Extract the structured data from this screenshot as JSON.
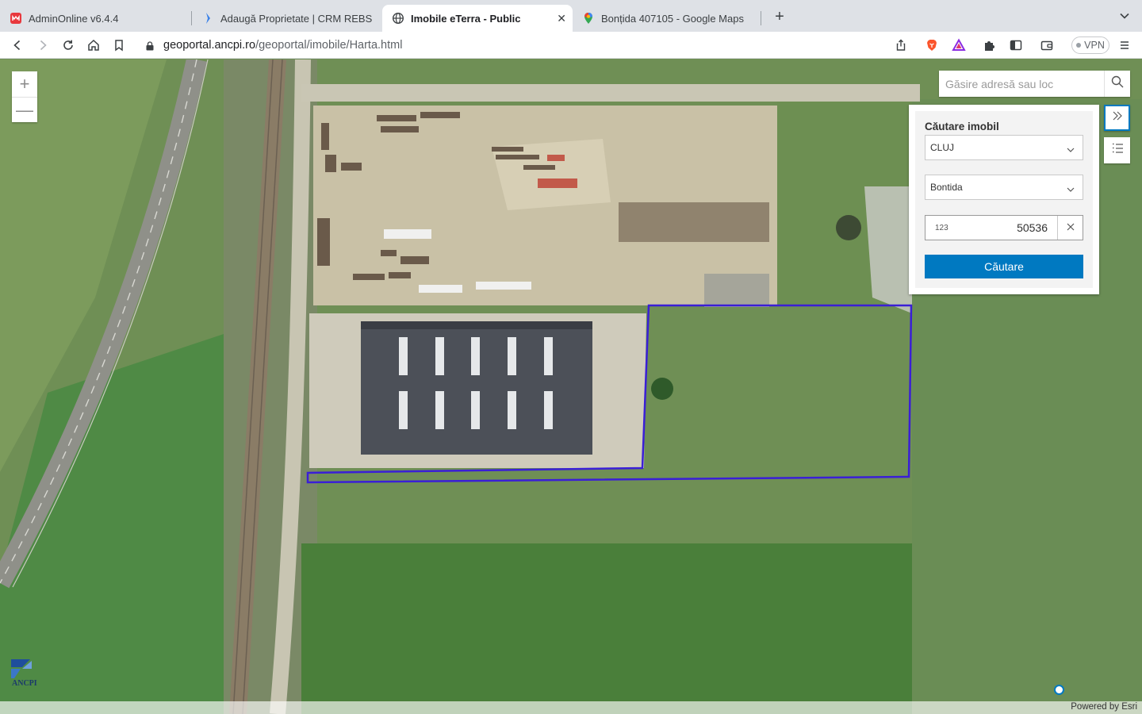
{
  "browser": {
    "tabs": [
      {
        "title": "AdminOnline v6.4.4",
        "icon": "admin-online-icon",
        "active": false
      },
      {
        "title": "Adaugă Proprietate | CRM REBS",
        "icon": "crm-icon",
        "active": false
      },
      {
        "title": "Imobile eTerra - Public",
        "icon": "globe-icon",
        "active": true
      },
      {
        "title": "Bonțida 407105 - Google Maps",
        "icon": "maps-pin-icon",
        "active": false
      }
    ],
    "new_tab_label": "+",
    "url_host": "geoportal.ancpi.ro",
    "url_path": "/geoportal/imobile/Harta.html",
    "vpn_label": "VPN",
    "colors": {
      "tabstrip": "#dee1e6",
      "active_tab": "#ffffff",
      "brave": "#fb542b"
    }
  },
  "map": {
    "zoom_in": "+",
    "zoom_out": "—",
    "search_placeholder": "Găsire adresă sau loc",
    "attribution": "Powered by Esri",
    "logo_text": "ANCPI",
    "parcel_outline_color": "#3a1fd6",
    "panel": {
      "title": "Căutare imobil",
      "county": "CLUJ",
      "locality": "Bontida",
      "number_prefix": "123",
      "number_value": "50536",
      "submit_label": "Căutare"
    },
    "accent": "#0079c1"
  }
}
